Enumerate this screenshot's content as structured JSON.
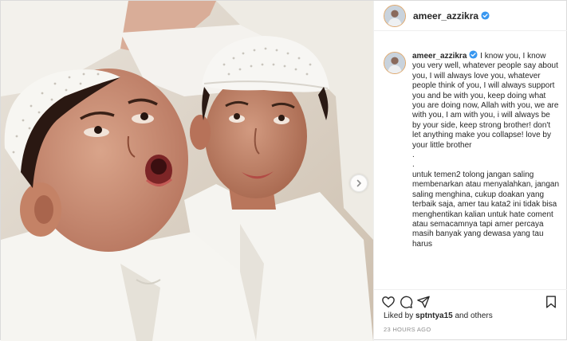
{
  "post": {
    "username": "ameer_azzikra",
    "verified": true,
    "caption": {
      "username": "ameer_azzikra",
      "english": "I know you, I know you very well, whatever people say about you, I will always love you, whatever people think of you, I will always support you and be with you, keep doing what you are doing now, Allah with you, we are with you, I am with you, i will always be by your side, keep strong brother! don't let anything make you collapse! love by your little brother",
      "dots": ".\n.",
      "indonesian": "untuk temen2 tolong jangan saling membenarkan atau menyalahkan, jangan saling menghina, cukup doakan yang terbaik saja, amer tau kata2 ini tidak bisa menghentikan kalian untuk hate coment atau semacamnya tapi amer percaya masih banyak yang dewasa yang tau harus"
    },
    "likes": {
      "prefix": "Liked by",
      "user": "sptntya15",
      "suffix": "and others"
    },
    "timestamp": "23 HOURS AGO"
  },
  "icons": {
    "like": "heart-icon",
    "comment": "comment-icon",
    "share": "share-icon",
    "save": "bookmark-icon",
    "next": "chevron-right-icon",
    "verified": "verified-badge-icon"
  },
  "colors": {
    "verified": "#3897f0",
    "text": "#262626",
    "muted": "#8e8e8e",
    "border": "#efefef"
  }
}
